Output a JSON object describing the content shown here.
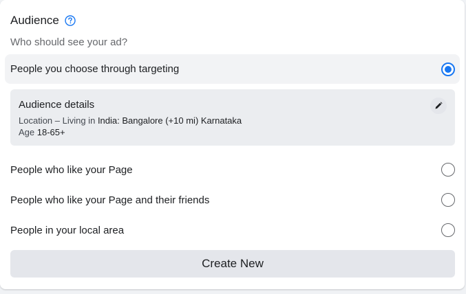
{
  "audience": {
    "title": "Audience",
    "help_icon": "question-circle-icon",
    "subtitle": "Who should see your ad?",
    "accent_color": "#1877f2",
    "options": [
      {
        "label": "People you choose through targeting",
        "selected": true
      },
      {
        "label": "People who like your Page",
        "selected": false
      },
      {
        "label": "People who like your Page and their friends",
        "selected": false
      },
      {
        "label": "People in your local area",
        "selected": false
      }
    ],
    "details": {
      "title": "Audience details",
      "location_label": "Location – Living in",
      "location_value": "India: Bangalore (+10 mi) Karnataka",
      "age_label": "Age",
      "age_value": "18-65+",
      "edit_icon": "pencil-icon"
    },
    "create_button_label": "Create New"
  }
}
